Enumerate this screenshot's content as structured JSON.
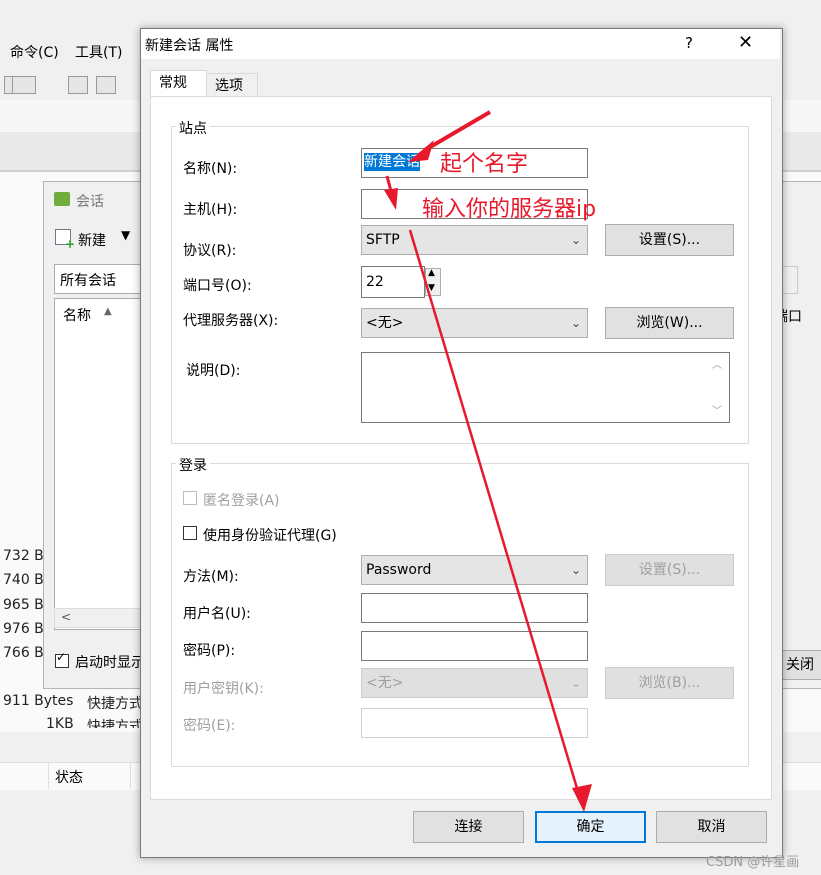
{
  "background": {
    "menu": [
      "命令(C)",
      "工具(T)"
    ],
    "sizes": [
      "732 B",
      "740 B",
      "965 B",
      "976 B",
      "766 B"
    ],
    "size_911": "911 Bytes",
    "quick_1": "快捷方式",
    "size_1kb": "1KB",
    "quick_2": "快捷方式",
    "status_header": "状态",
    "close_button": "关闭",
    "port_col": "端口"
  },
  "sessions_window": {
    "title": "会话",
    "new_button": "新建",
    "filter": "所有会话",
    "name_header": "名称",
    "startup_checkbox": "启动时显示",
    "startup_checked": true
  },
  "dialog": {
    "title": "新建会话 属性",
    "help": "?",
    "close": "✕",
    "tabs": [
      "常规",
      "选项"
    ],
    "site_group": "站点",
    "name_label": "名称(N):",
    "name_value": "新建会话",
    "host_label": "主机(H):",
    "host_value": "",
    "protocol_label": "协议(R):",
    "protocol_value": "SFTP",
    "settings_button": "设置(S)...",
    "port_label": "端口号(O):",
    "port_value": "22",
    "proxy_label": "代理服务器(X):",
    "proxy_value": "<无>",
    "browse_button": "浏览(W)...",
    "desc_label": "说明(D):",
    "login_group": "登录",
    "anon_label": "匿名登录(A)",
    "agent_label": "使用身份验证代理(G)",
    "method_label": "方法(M):",
    "method_value": "Password",
    "method_settings": "设置(S)...",
    "user_label": "用户名(U):",
    "pwd_label": "密码(P):",
    "key_label": "用户密钥(K):",
    "key_value": "<无>",
    "key_browse": "浏览(B)...",
    "passphrase_label": "密码(E):",
    "connect": "连接",
    "ok": "确定",
    "cancel": "取消"
  },
  "annotations": {
    "name_hint": "起个名字",
    "host_hint": "输入你的服务器ip",
    "color": "#e8192c"
  },
  "watermark": "CSDN @许星画"
}
